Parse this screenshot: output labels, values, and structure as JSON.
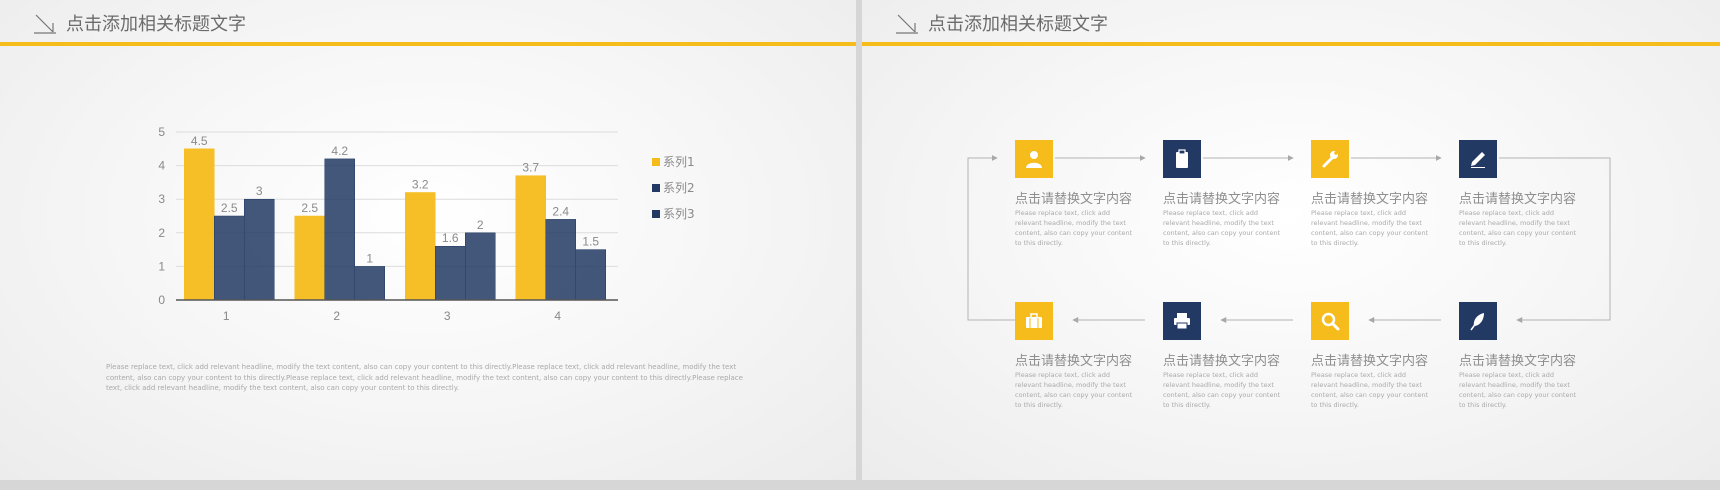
{
  "left_slide": {
    "title": "点击添加相关标题文字",
    "caption": "Please replace text, click add relevant headline, modify the text content, also can copy your content to this directly.Please replace text, click add relevant headline, modify the text content, also can copy your content to this directly.Please replace text, click add relevant headline, modify the text content, also can copy your content to this directly.Please replace text, click add relevant headline, modify the text content, also can copy your content to this directly."
  },
  "chart_data": {
    "type": "bar",
    "title": "",
    "xlabel": "",
    "ylabel": "",
    "categories": [
      "1",
      "2",
      "3",
      "4"
    ],
    "series": [
      {
        "name": "系列1",
        "values": [
          4.5,
          2.5,
          3.2,
          3.7
        ],
        "color": "#f5bc1c"
      },
      {
        "name": "系列2",
        "values": [
          2.5,
          4.2,
          1.6,
          2.4
        ],
        "color": "#223a63"
      },
      {
        "name": "系列3",
        "values": [
          3,
          1,
          2,
          1.5
        ],
        "color": "#223a63"
      }
    ],
    "ylim": [
      0,
      5
    ],
    "yticks": [
      "0",
      "1",
      "2",
      "3",
      "4",
      "5"
    ],
    "grid": true,
    "data_labels": true,
    "legend_position": "right"
  },
  "right_slide": {
    "title": "点击添加相关标题文字",
    "nodes": [
      {
        "icon": "user-icon",
        "color": "#f5bc1c",
        "title": "点击请替换文字内容",
        "desc": "Please replace text, click add relevant headline, modify the text content, also can copy your content to this directly."
      },
      {
        "icon": "clipboard-icon",
        "color": "#223a63",
        "title": "点击请替换文字内容",
        "desc": "Please replace text, click add relevant headline, modify the text content, also can copy your content to this directly."
      },
      {
        "icon": "wrench-icon",
        "color": "#f5bc1c",
        "title": "点击请替换文字内容",
        "desc": "Please replace text, click add relevant headline, modify the text content, also can copy your content to this directly."
      },
      {
        "icon": "pencil-icon",
        "color": "#223a63",
        "title": "点击请替换文字内容",
        "desc": "Please replace text, click add relevant headline, modify the text content, also can copy your content to this directly."
      },
      {
        "icon": "briefcase-icon",
        "color": "#f5bc1c",
        "title": "点击请替换文字内容",
        "desc": "Please replace text, click add relevant headline, modify the text content, also can copy your content to this directly."
      },
      {
        "icon": "printer-icon",
        "color": "#223a63",
        "title": "点击请替换文字内容",
        "desc": "Please replace text, click add relevant headline, modify the text content, also can copy your content to this directly."
      },
      {
        "icon": "search-icon",
        "color": "#f5bc1c",
        "title": "点击请替换文字内容",
        "desc": "Please replace text, click add relevant headline, modify the text content, also can copy your content to this directly."
      },
      {
        "icon": "feather-icon",
        "color": "#223a63",
        "title": "点击请替换文字内容",
        "desc": "Please replace text, click add relevant headline, modify the text content, also can copy your content to this directly."
      }
    ]
  }
}
